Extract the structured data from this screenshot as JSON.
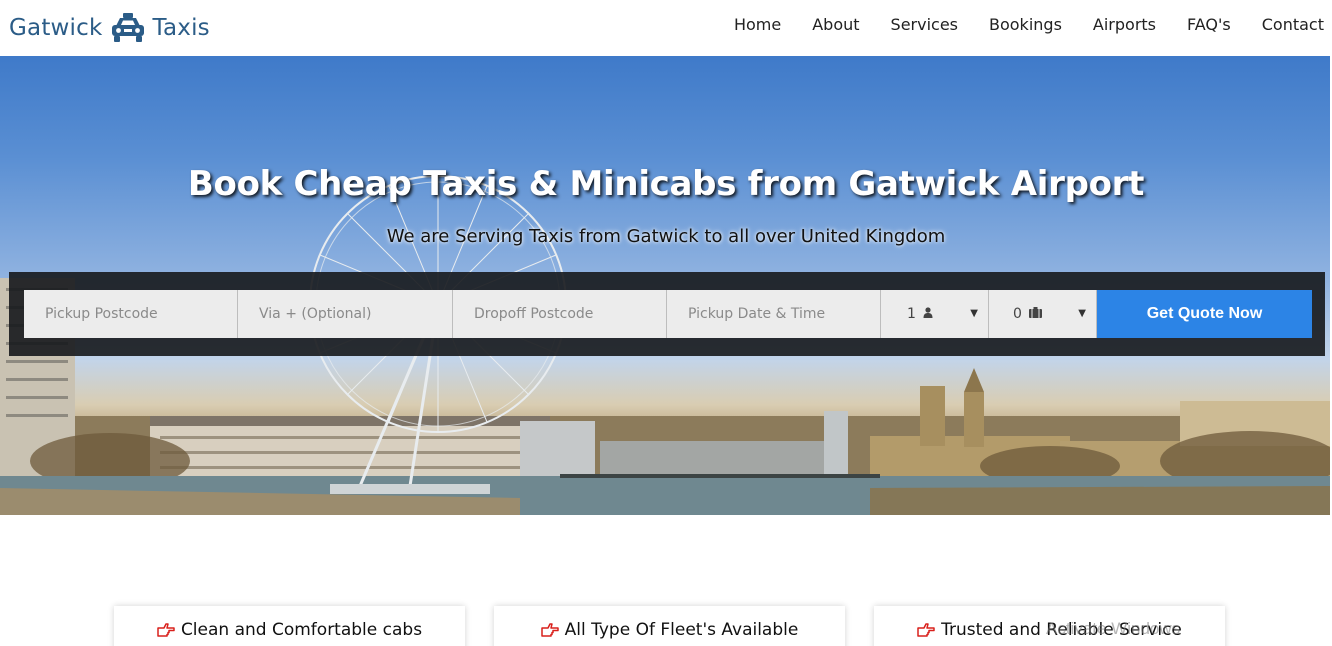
{
  "brand": {
    "name_left": "Gatwick",
    "name_right": "Taxis",
    "logo_icon": "taxi-icon",
    "color": "#2b5c87"
  },
  "nav": {
    "items": [
      {
        "label": "Home"
      },
      {
        "label": "About"
      },
      {
        "label": "Services"
      },
      {
        "label": "Bookings"
      },
      {
        "label": "Airports"
      },
      {
        "label": "FAQ's"
      },
      {
        "label": "Contact"
      }
    ]
  },
  "hero": {
    "title": "Book Cheap Taxis & Minicabs from Gatwick Airport",
    "subtitle": "We are Serving Taxis from Gatwick to all over United Kingdom"
  },
  "quote_form": {
    "pickup_placeholder": "Pickup Postcode",
    "via_placeholder": "Via + (Optional)",
    "dropoff_placeholder": "Dropoff Postcode",
    "datetime_placeholder": "Pickup Date & Time",
    "passengers_value": "1",
    "passengers_icon": "user-icon",
    "luggage_value": "0",
    "luggage_icon": "suitcase-icon",
    "submit_label": "Get Quote Now",
    "accent_color": "#2c84e6"
  },
  "features": [
    {
      "label": "Clean and Comfortable cabs",
      "icon": "hand-point-right-icon"
    },
    {
      "label": "All Type Of Fleet's Available",
      "icon": "hand-point-right-icon"
    },
    {
      "label": "Trusted and Reliable Service",
      "icon": "hand-point-right-icon"
    }
  ],
  "watermark": "Activate Windows"
}
